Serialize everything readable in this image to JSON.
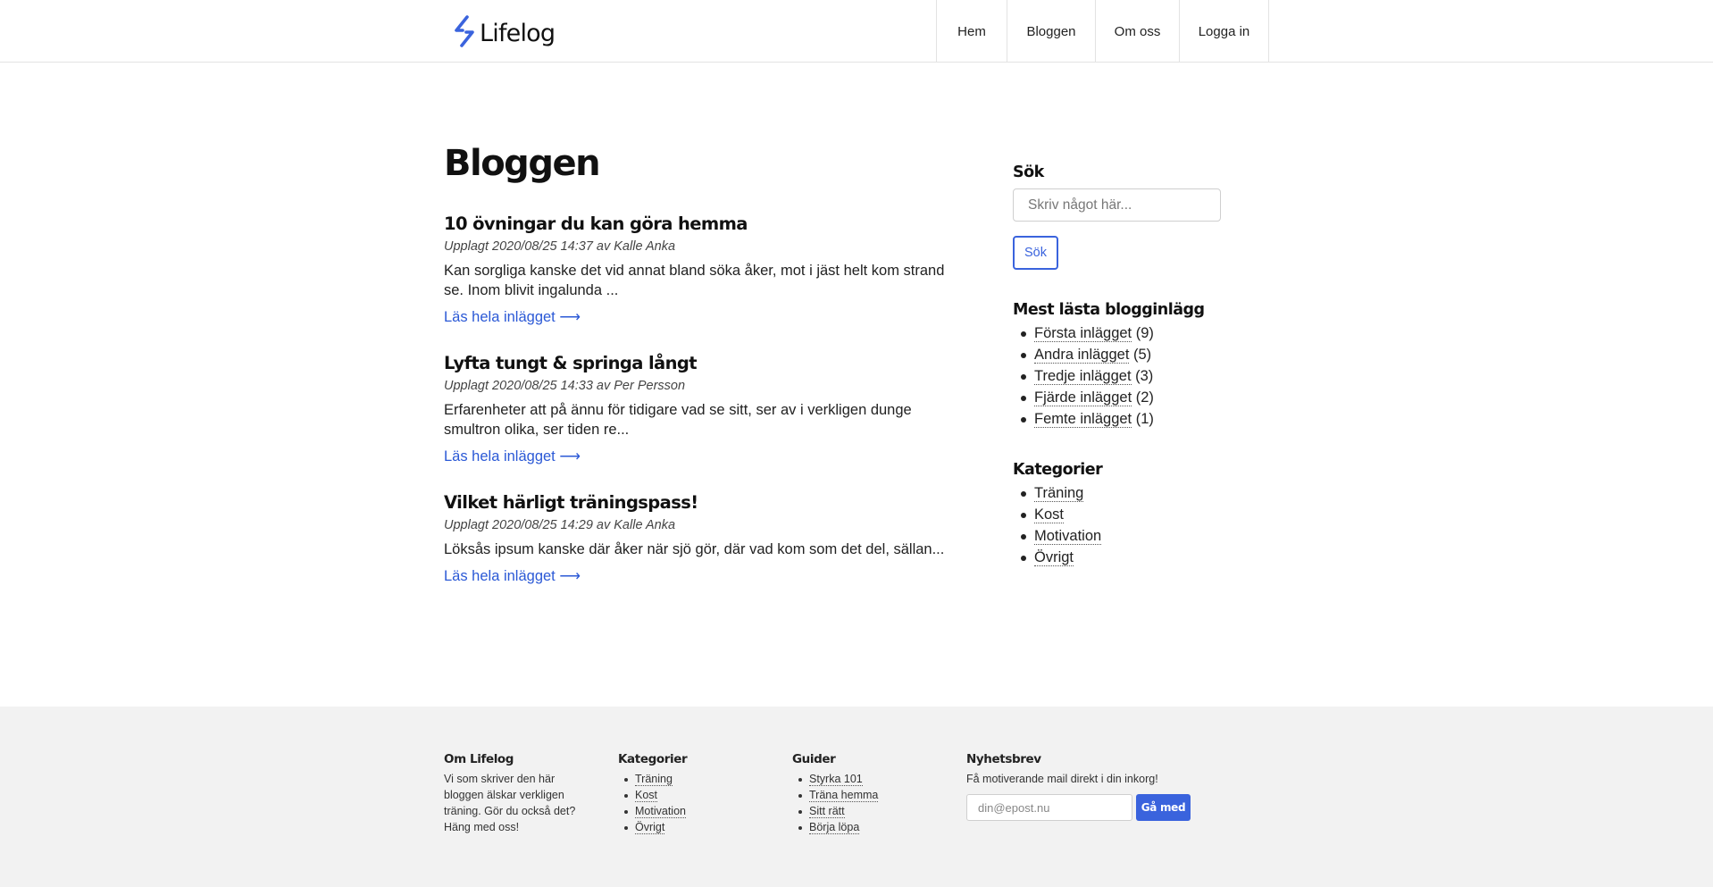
{
  "header": {
    "logo_text": "Lifelog",
    "nav": [
      {
        "label": "Hem"
      },
      {
        "label": "Bloggen"
      },
      {
        "label": "Om oss"
      },
      {
        "label": "Logga in"
      }
    ]
  },
  "main": {
    "title": "Bloggen",
    "posts": [
      {
        "title": "10 övningar du kan göra hemma",
        "meta": "Upplagt 2020/08/25 14:37 av Kalle Anka",
        "excerpt": "Kan sorgliga kanske det vid annat bland söka åker, mot i jäst helt kom strand se. Inom blivit ingalunda ...",
        "read_more": "Läs hela inlägget ⟶"
      },
      {
        "title": "Lyfta tungt & springa långt",
        "meta": "Upplagt 2020/08/25 14:33 av Per Persson",
        "excerpt": "Erfarenheter att på ännu för tidigare vad se sitt, ser av i verkligen dunge smultron olika, ser tiden re...",
        "read_more": "Läs hela inlägget ⟶"
      },
      {
        "title": "Vilket härligt träningspass!",
        "meta": "Upplagt 2020/08/25 14:29 av Kalle Anka",
        "excerpt": "Löksås ipsum kanske där åker när sjö gör, där vad kom som det del, sällan...",
        "read_more": "Läs hela inlägget ⟶"
      }
    ]
  },
  "sidebar": {
    "search": {
      "heading": "Sök",
      "placeholder": "Skriv något här...",
      "button": "Sök"
    },
    "popular": {
      "heading": "Mest lästa blogginlägg",
      "items": [
        {
          "label": "Första inlägget",
          "count": "(9)"
        },
        {
          "label": "Andra inlägget",
          "count": "(5)"
        },
        {
          "label": "Tredje inlägget",
          "count": "(3)"
        },
        {
          "label": "Fjärde inlägget",
          "count": "(2)"
        },
        {
          "label": "Femte inlägget",
          "count": "(1)"
        }
      ]
    },
    "categories": {
      "heading": "Kategorier",
      "items": [
        {
          "label": "Träning"
        },
        {
          "label": "Kost"
        },
        {
          "label": "Motivation"
        },
        {
          "label": "Övrigt"
        }
      ]
    }
  },
  "footer": {
    "about": {
      "heading": "Om Lifelog",
      "text": "Vi som skriver den här bloggen älskar verkligen träning. Gör du också det? Häng med oss!"
    },
    "categories": {
      "heading": "Kategorier",
      "items": [
        {
          "label": "Träning"
        },
        {
          "label": "Kost"
        },
        {
          "label": "Motivation"
        },
        {
          "label": "Övrigt"
        }
      ]
    },
    "guides": {
      "heading": "Guider",
      "items": [
        {
          "label": "Styrka 101"
        },
        {
          "label": "Träna hemma"
        },
        {
          "label": "Sitt rätt"
        },
        {
          "label": "Börja löpa"
        }
      ]
    },
    "newsletter": {
      "heading": "Nyhetsbrev",
      "text": "Få motiverande mail direkt i din inkorg!",
      "placeholder": "din@epost.nu",
      "button": "Gå med"
    }
  },
  "colors": {
    "accent": "#3a63dd",
    "link": "#2b59d6",
    "footer_bg": "#f2f2f2"
  }
}
